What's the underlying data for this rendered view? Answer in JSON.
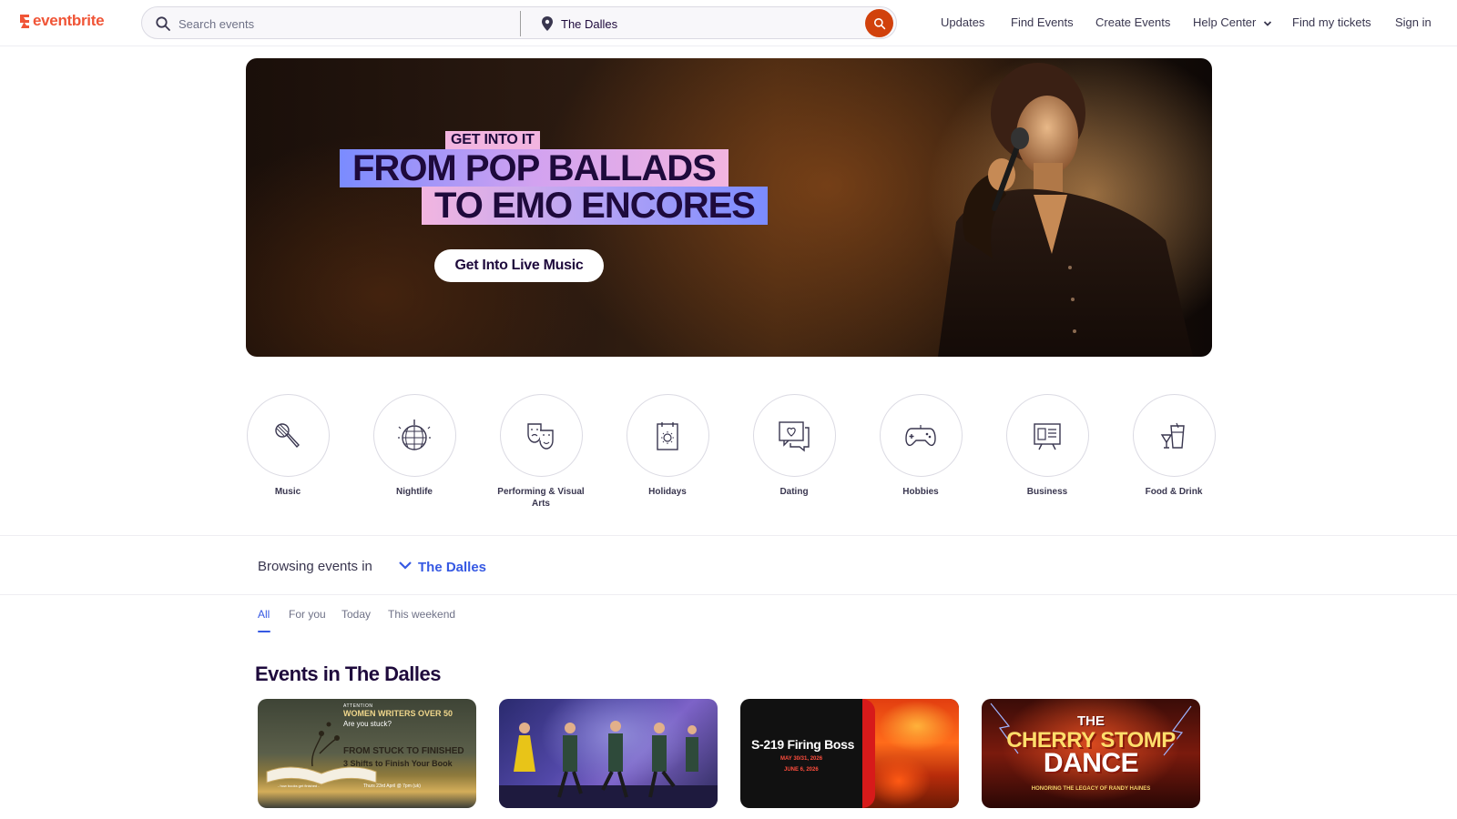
{
  "brand": {
    "name": "eventbrite",
    "color": "#f05537"
  },
  "search": {
    "placeholder": "Search events",
    "location_value": "The Dalles",
    "search_icon": "search-icon",
    "location_icon": "map-pin-icon"
  },
  "nav": {
    "items": [
      {
        "label": "Updates"
      },
      {
        "label": "Find Events"
      },
      {
        "label": "Create Events"
      },
      {
        "label": "Help Center"
      },
      {
        "label": "Find my tickets"
      },
      {
        "label": "Sign in"
      }
    ]
  },
  "hero": {
    "tag": "GET INTO IT",
    "line1": "FROM POP BALLADS",
    "line2": "TO EMO ENCORES",
    "cta": "Get Into Live Music"
  },
  "categories": [
    {
      "label": "Music",
      "icon": "microphone-icon"
    },
    {
      "label": "Nightlife",
      "icon": "disco-ball-icon"
    },
    {
      "label": "Performing & Visual Arts",
      "icon": "theater-masks-icon"
    },
    {
      "label": "Holidays",
      "icon": "calendar-sun-icon"
    },
    {
      "label": "Dating",
      "icon": "chat-heart-icon"
    },
    {
      "label": "Hobbies",
      "icon": "gamepad-icon"
    },
    {
      "label": "Business",
      "icon": "presentation-icon"
    },
    {
      "label": "Food & Drink",
      "icon": "drinks-icon"
    }
  ],
  "browse": {
    "label": "Browsing events in",
    "city": "The Dalles"
  },
  "tabs": [
    {
      "label": "All",
      "active": true
    },
    {
      "label": "For you"
    },
    {
      "label": "Today"
    },
    {
      "label": "This weekend"
    }
  ],
  "section_title": "Events in The Dalles",
  "cards": {
    "c1": {
      "attention": "ATTENTION",
      "women": "WOMEN WRITERS OVER 50",
      "stuck": "Are you stuck?",
      "from": "FROM STUCK TO FINISHED",
      "shifts": "3 Shifts to Finish Your Book",
      "date": "Thurs 23rd April @ 7pm (uk)",
      "books": "- how books get finished -"
    },
    "c3": {
      "title": "S-219 Firing Boss",
      "d1": "MAY 30/31, 2026",
      "d2": "JUNE 6, 2026"
    },
    "c4": {
      "the": "THE",
      "cherry": "CHERRY STOMP",
      "dance": "DANCE",
      "honoring": "HONORING THE LEGACY OF RANDY HAINES"
    }
  },
  "colors": {
    "accent_blue": "#3659e3",
    "search_button": "#d1410c",
    "text_dark": "#1e0a3c"
  }
}
